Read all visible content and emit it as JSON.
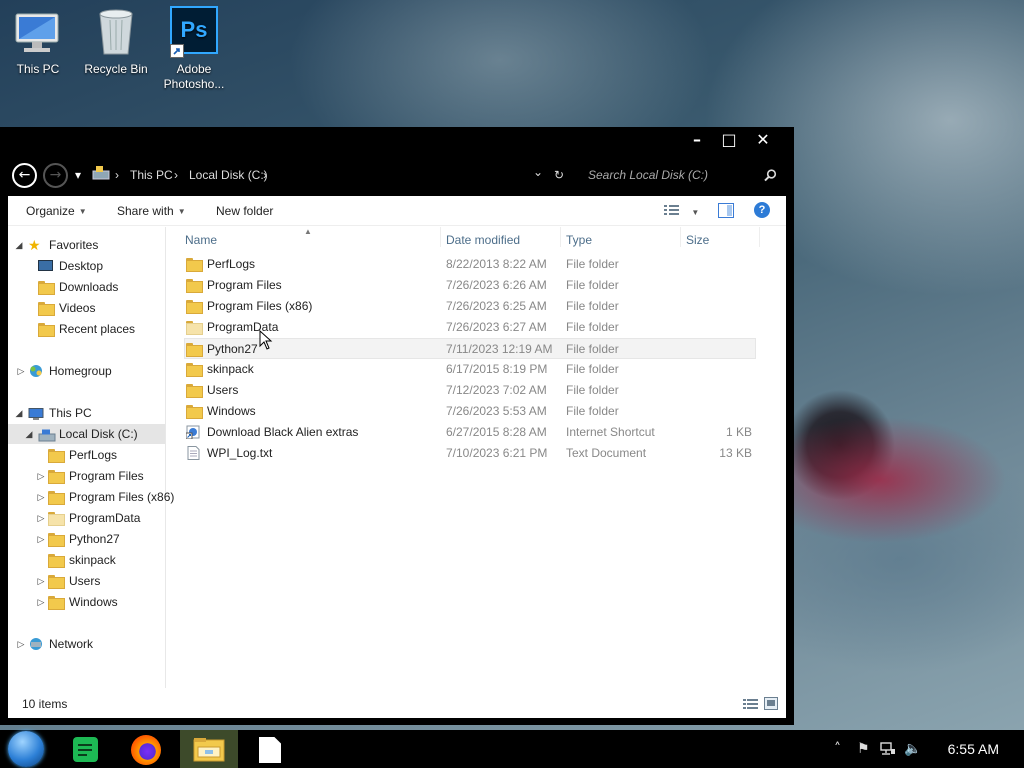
{
  "desktop": {
    "icons": [
      {
        "label": "This PC",
        "icon": "monitor-icon"
      },
      {
        "label": "Recycle Bin",
        "icon": "recycle-bin-icon"
      },
      {
        "label": "Adobe Photosho...",
        "icon": "photoshop-icon",
        "glyph": "Ps"
      }
    ]
  },
  "window": {
    "caption": {
      "minimize": "–",
      "maximize": "□",
      "close": "✕"
    },
    "nav": {
      "back": "←",
      "forward": "→",
      "recent": "▾",
      "breadcrumb": [
        "This PC",
        "Local Disk (C:)"
      ],
      "separator": "›",
      "dropdown": "⌄",
      "refresh": "↻",
      "search_placeholder": "Search Local Disk (C:)"
    },
    "toolbar": {
      "organize": "Organize",
      "share_with": "Share with",
      "new_folder": "New folder",
      "help": "?"
    },
    "nav_pane": {
      "favorites": {
        "label": "Favorites",
        "items": [
          "Desktop",
          "Downloads",
          "Videos",
          "Recent places"
        ]
      },
      "homegroup": "Homegroup",
      "this_pc": "This PC",
      "local_disk": "Local Disk (C:)",
      "local_disk_children": [
        "PerfLogs",
        "Program Files",
        "Program Files (x86)",
        "ProgramData",
        "Python27",
        "skinpack",
        "Users",
        "Windows"
      ],
      "network": "Network"
    },
    "columns": {
      "name": "Name",
      "date": "Date modified",
      "type": "Type",
      "size": "Size"
    },
    "files": [
      {
        "name": "PerfLogs",
        "date": "8/22/2013 8:22 AM",
        "type": "File folder",
        "size": ""
      },
      {
        "name": "Program Files",
        "date": "7/26/2023 6:26 AM",
        "type": "File folder",
        "size": ""
      },
      {
        "name": "Program Files (x86)",
        "date": "7/26/2023 6:25 AM",
        "type": "File folder",
        "size": ""
      },
      {
        "name": "ProgramData",
        "date": "7/26/2023 6:27 AM",
        "type": "File folder",
        "size": ""
      },
      {
        "name": "Python27",
        "date": "7/11/2023 12:19 AM",
        "type": "File folder",
        "size": ""
      },
      {
        "name": "skinpack",
        "date": "6/17/2015 8:19 PM",
        "type": "File folder",
        "size": ""
      },
      {
        "name": "Users",
        "date": "7/12/2023 7:02 AM",
        "type": "File folder",
        "size": ""
      },
      {
        "name": "Windows",
        "date": "7/26/2023 5:53 AM",
        "type": "File folder",
        "size": ""
      },
      {
        "name": "Download Black Alien extras",
        "date": "6/27/2015 8:28 AM",
        "type": "Internet Shortcut",
        "size": "1 KB"
      },
      {
        "name": "WPI_Log.txt",
        "date": "7/10/2023 6:21 PM",
        "type": "Text Document",
        "size": "13 KB"
      }
    ],
    "status": "10 items"
  },
  "taskbar": {
    "apps": [
      "start-orb-icon",
      "notes-app-icon",
      "firefox-icon",
      "file-explorer-icon",
      "blank-document-icon"
    ],
    "clock": "6:55 AM",
    "tray": {
      "chevron": "˄",
      "flag": "⚑",
      "speaker": "🔈"
    }
  }
}
